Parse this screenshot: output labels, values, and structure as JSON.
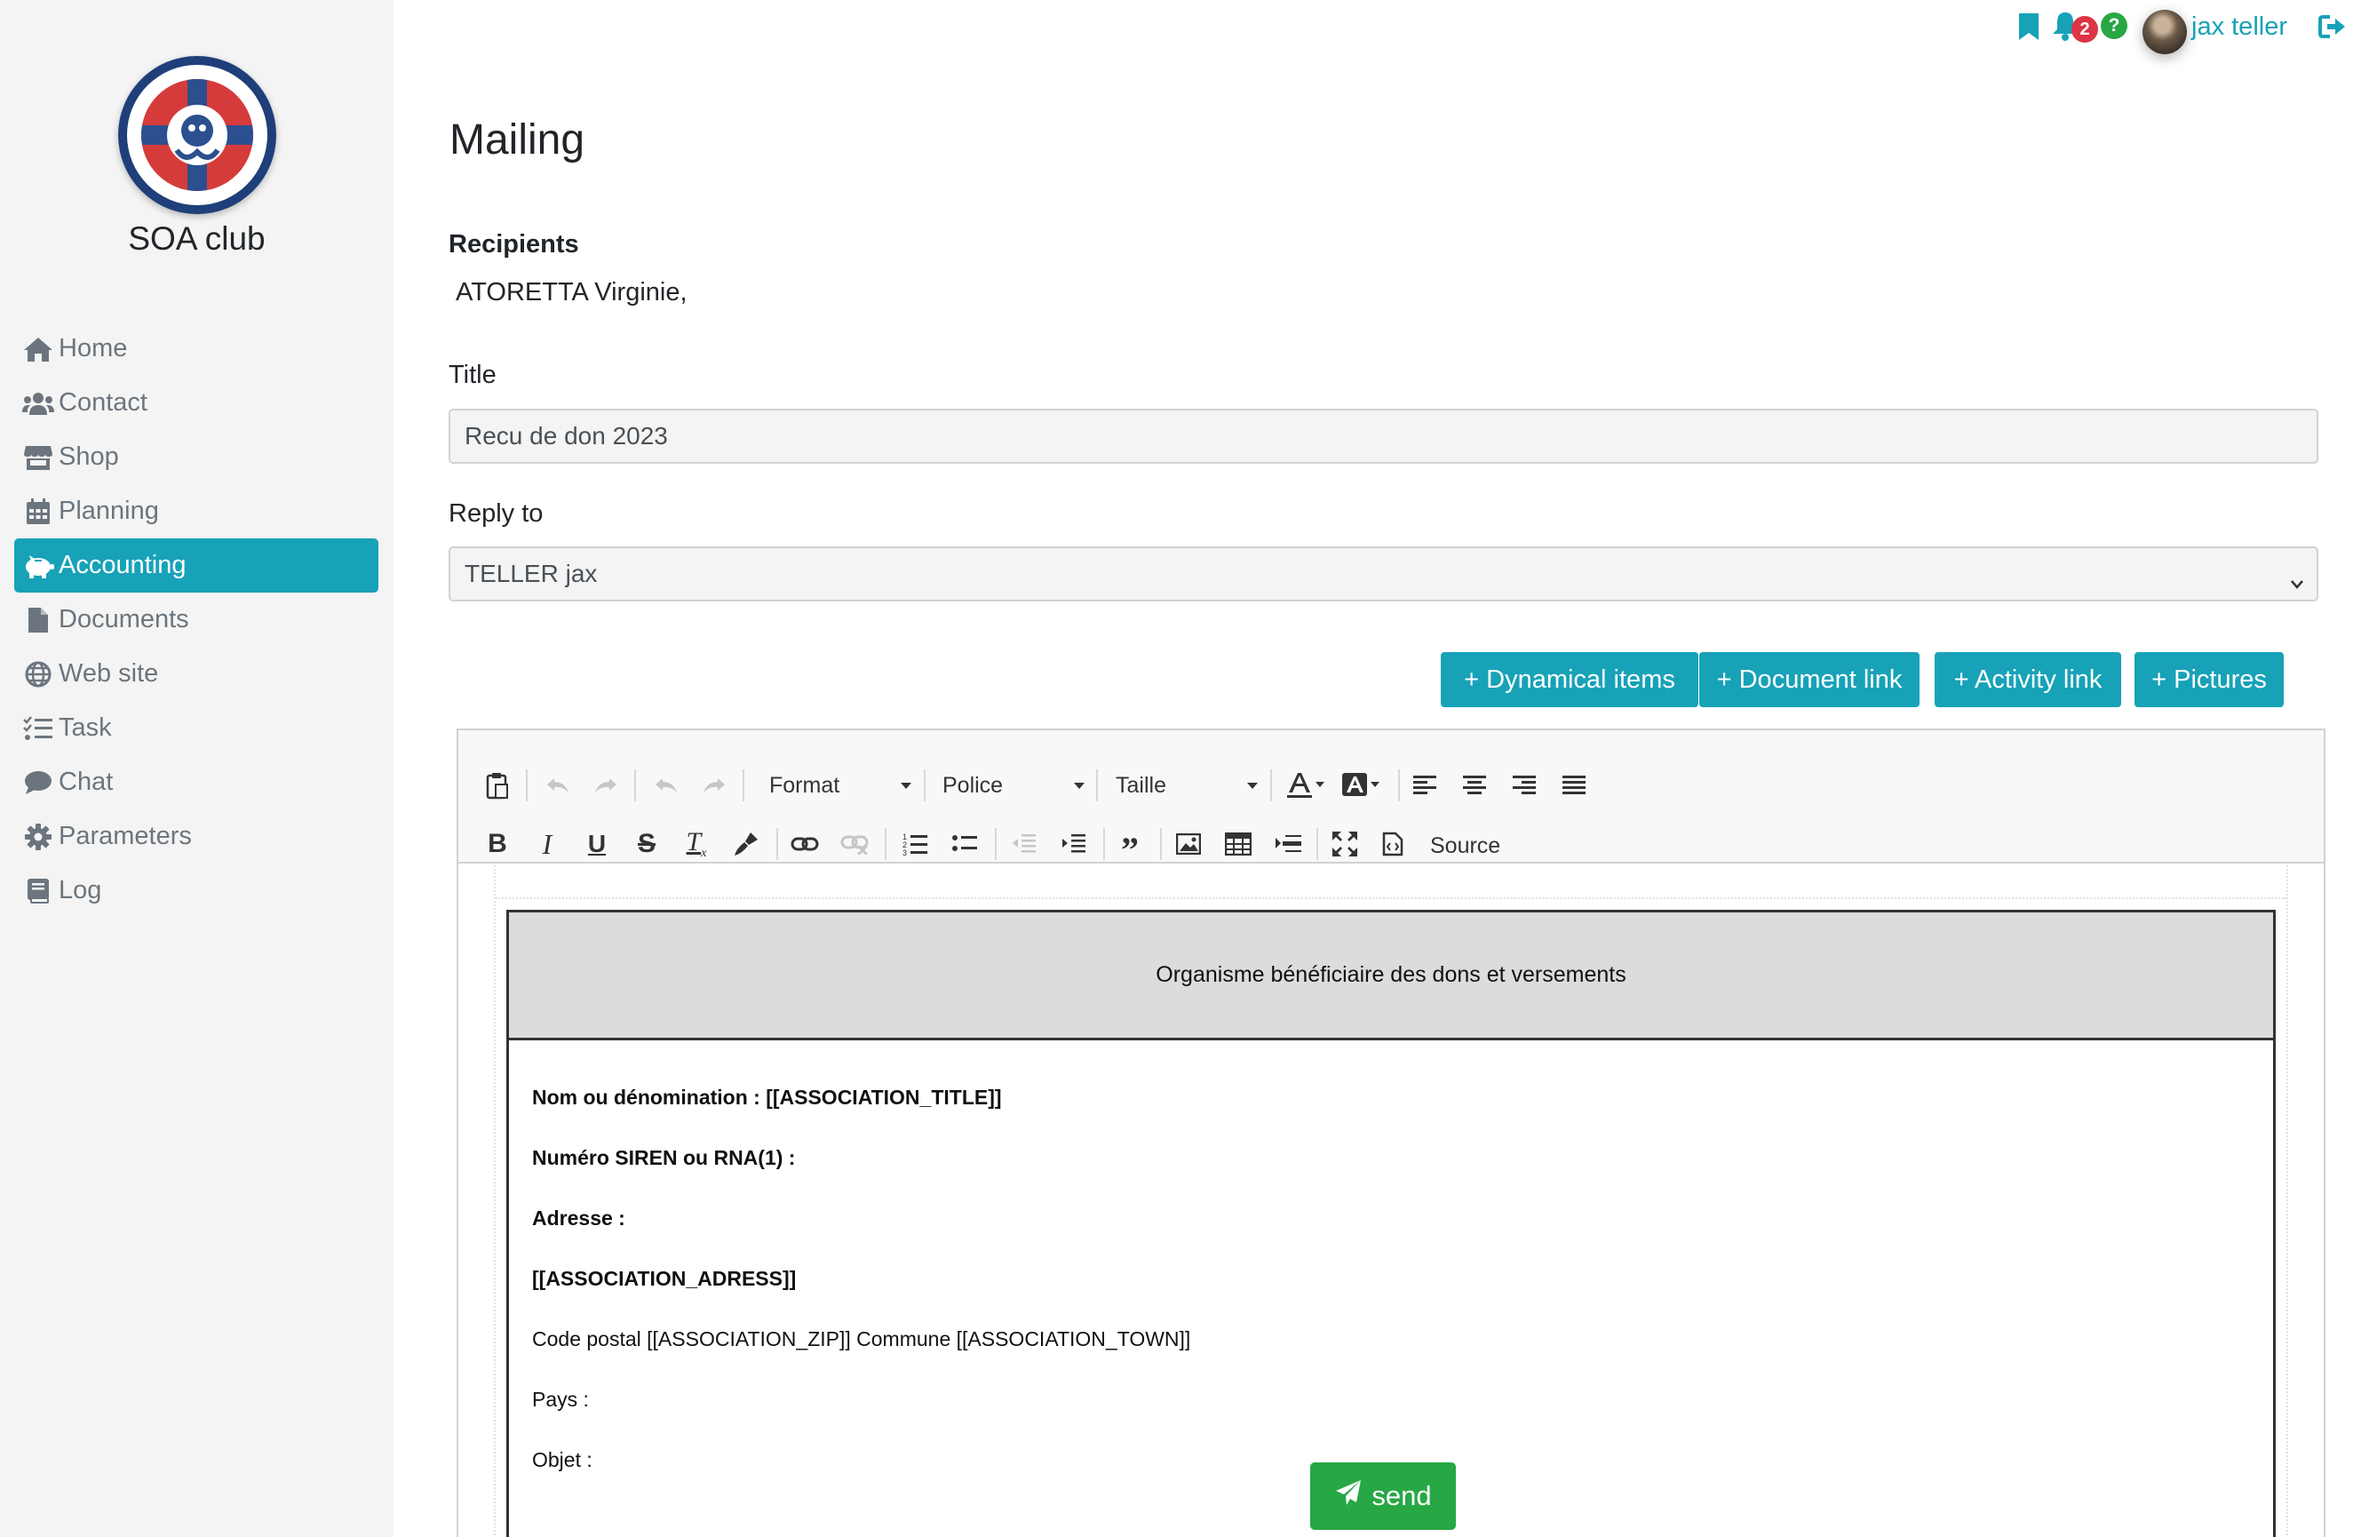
{
  "sidebar": {
    "club_name": "SOA club",
    "logo_alt": "logo",
    "items": [
      {
        "label": "Home",
        "icon": "home-icon"
      },
      {
        "label": "Contact",
        "icon": "users-icon"
      },
      {
        "label": "Shop",
        "icon": "store-icon"
      },
      {
        "label": "Planning",
        "icon": "calendar-icon"
      },
      {
        "label": "Accounting",
        "icon": "piggy-bank-icon",
        "active": true
      },
      {
        "label": "Documents",
        "icon": "file-icon"
      },
      {
        "label": "Web site",
        "icon": "globe-icon"
      },
      {
        "label": "Task",
        "icon": "tasks-icon"
      },
      {
        "label": "Chat",
        "icon": "comment-icon"
      },
      {
        "label": "Parameters",
        "icon": "gear-icon"
      },
      {
        "label": "Log",
        "icon": "book-icon"
      }
    ]
  },
  "topbar": {
    "notifications_count": "2",
    "help_label": "?",
    "user_name": "jax teller"
  },
  "main": {
    "title": "Mailing",
    "recipients_label": "Recipients",
    "recipients_value": "ATORETTA Virginie,",
    "title_label": "Title",
    "title_value": "Recu de don 2023",
    "reply_to_label": "Reply to",
    "reply_to_value": "TELLER jax",
    "buttons": {
      "dynamical_items": "+ Dynamical items",
      "document_link": "+ Document link",
      "activity_link": "+ Activity link",
      "pictures": "+ Pictures"
    },
    "send_label": "send"
  },
  "editor": {
    "format_label": "Format",
    "font_label": "Police",
    "size_label": "Taille",
    "source_label": "Source",
    "document": {
      "header": "Organisme bénéficiaire des dons et versements",
      "lines": [
        {
          "text": "Nom ou dénomination :  [[ASSOCIATION_TITLE]]",
          "bold": true
        },
        {
          "text": "Numéro SIREN ou RNA(1) :",
          "bold": true
        },
        {
          "text": "Adresse :",
          "bold": true
        },
        {
          "text": "[[ASSOCIATION_ADRESS]]",
          "bold": true
        },
        {
          "text": "Code postal [[ASSOCIATION_ZIP]] Commune [[ASSOCIATION_TOWN]]",
          "bold": false
        },
        {
          "text": "Pays :",
          "bold": false
        },
        {
          "text": "Objet :",
          "bold": false
        }
      ]
    }
  },
  "colors": {
    "accent": "#17a2b8",
    "success": "#28a745",
    "danger": "#dc3545",
    "sidebar_bg": "#f4f4f4"
  }
}
